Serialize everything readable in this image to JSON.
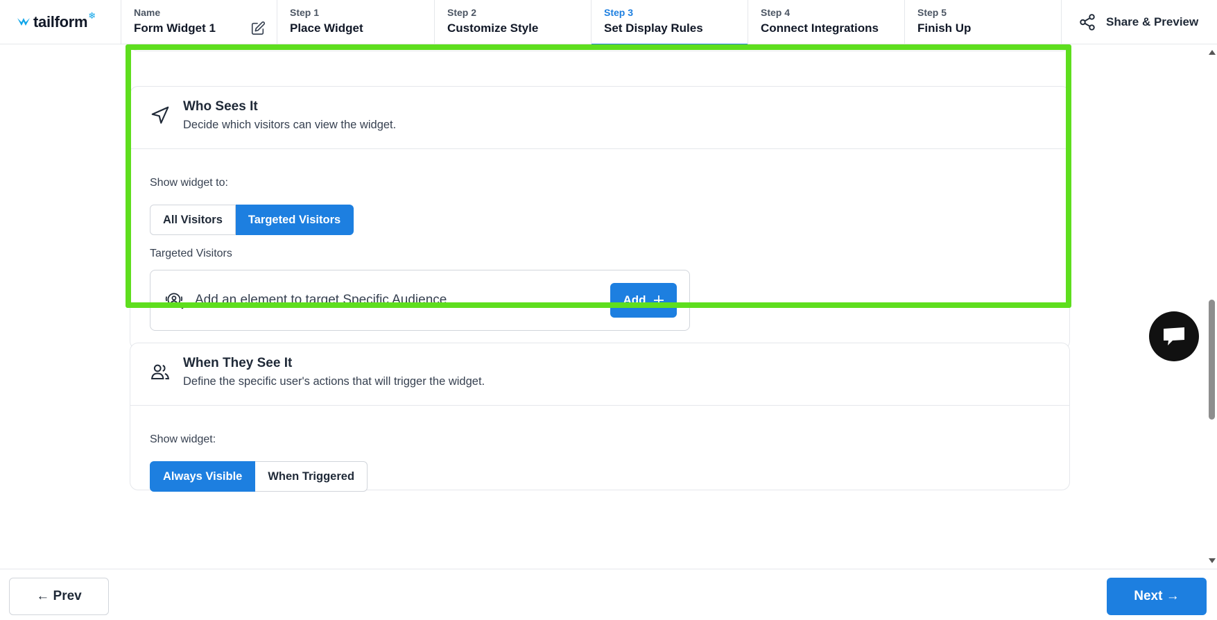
{
  "brand": {
    "name": "tailform",
    "accent": "#1d7fe0",
    "highlight": "#5ede1e"
  },
  "header": {
    "name_key": "Name",
    "name_value": "Form Widget 1",
    "steps": [
      {
        "key": "Step 1",
        "label": "Place Widget"
      },
      {
        "key": "Step 2",
        "label": "Customize Style"
      },
      {
        "key": "Step 3",
        "label": "Set Display Rules",
        "active": true
      },
      {
        "key": "Step 4",
        "label": "Connect Integrations"
      },
      {
        "key": "Step 5",
        "label": "Finish Up"
      }
    ],
    "share_label": "Share & Preview"
  },
  "who_sees_it": {
    "title": "Who Sees It",
    "subtitle": "Decide which visitors can view the widget.",
    "show_label": "Show widget to:",
    "options": [
      "All Visitors",
      "Targeted Visitors"
    ],
    "selected": "Targeted Visitors",
    "targeted_label": "Targeted Visitors",
    "target_prompt": "Add an element to target Specific Audience",
    "add_label": "Add"
  },
  "when_they_see_it": {
    "title": "When They See It",
    "subtitle": "Define the specific user's actions that will trigger the widget.",
    "show_label": "Show widget:",
    "options": [
      "Always Visible",
      "When Triggered"
    ],
    "selected": "Always Visible"
  },
  "footer": {
    "prev_label": "← Prev",
    "next_label": "Next →"
  }
}
